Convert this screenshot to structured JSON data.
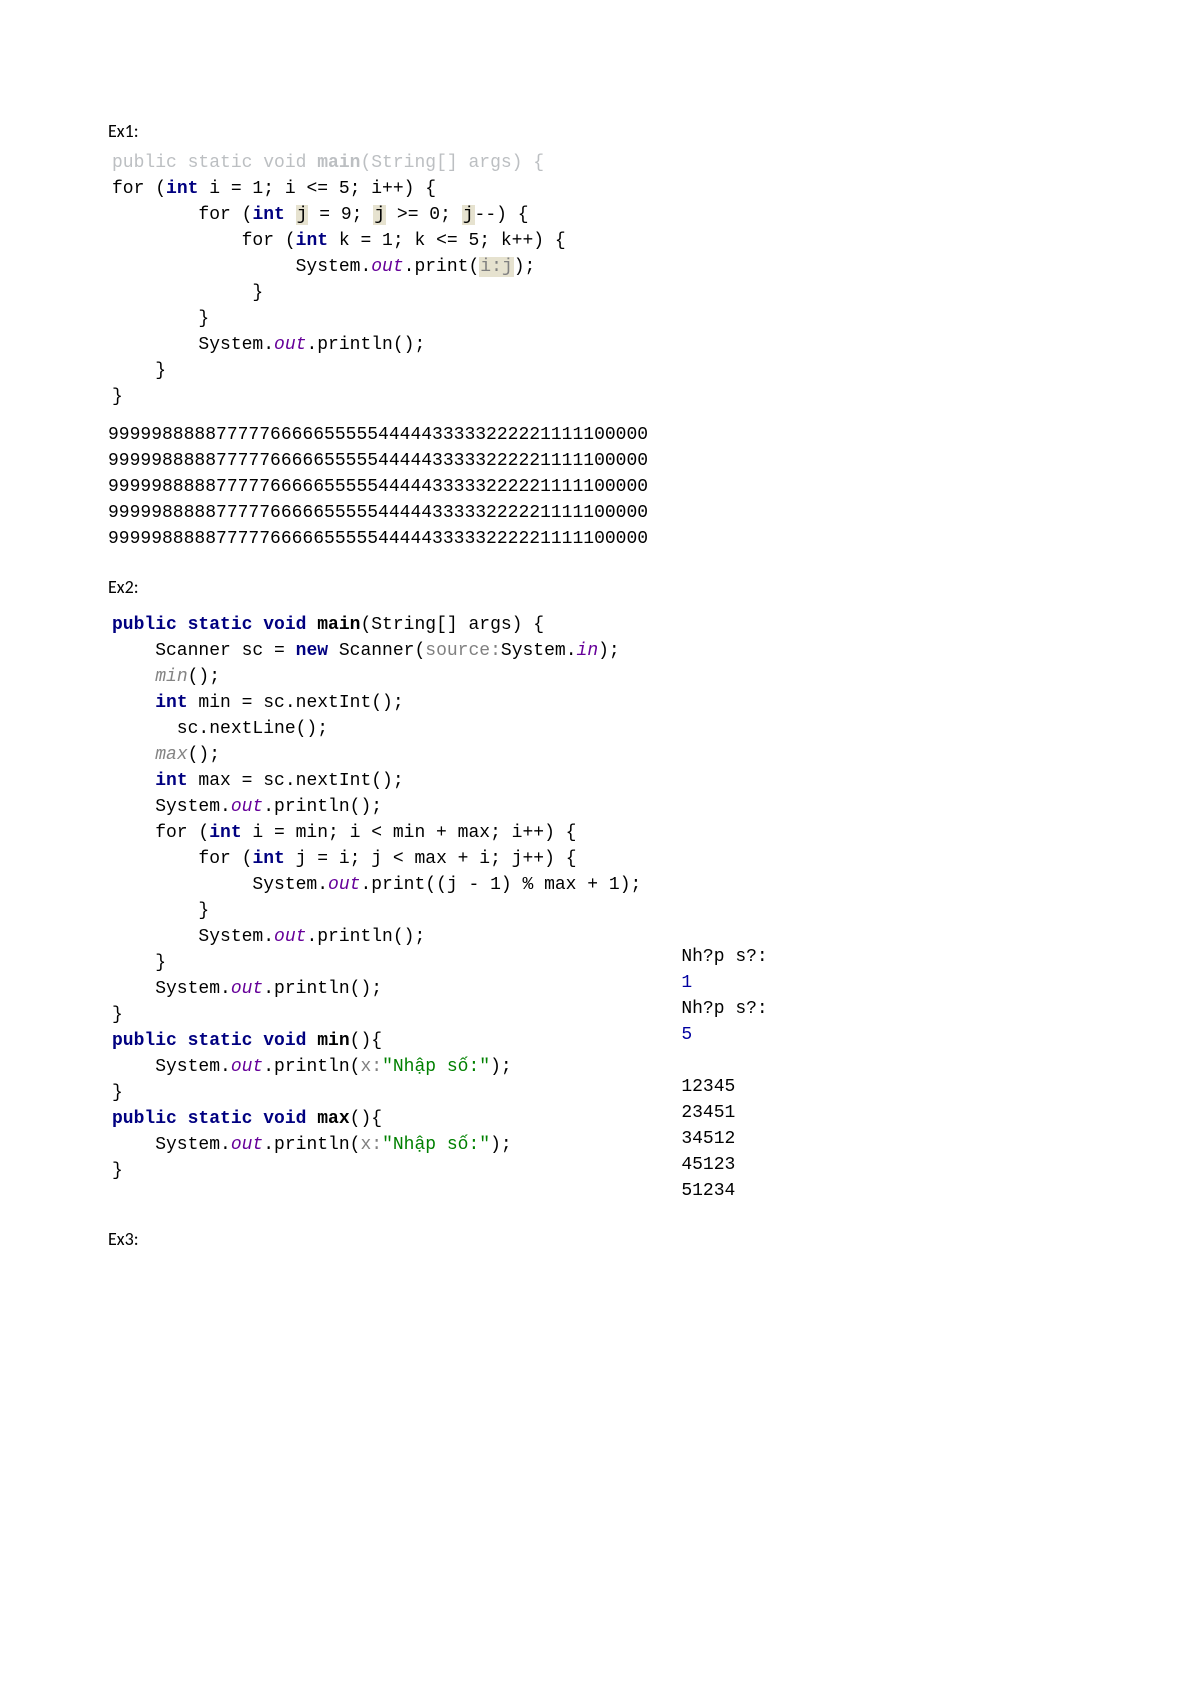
{
  "ex1": {
    "label": "Ex1:",
    "code": {
      "l0_pre": "public static void ",
      "l0_main": "main",
      "l0_post": "(String[] args) {",
      "l1_pre": "for (",
      "l1_int": "int",
      "l1_mid": " i = 1; i <= 5; i++) {",
      "l2_pre": "        for (",
      "l2_int": "int",
      "l2_a": " ",
      "l2_j1": "j",
      "l2_b": " = 9; ",
      "l2_j2": "j",
      "l2_c": " >= 0; ",
      "l2_j3": "j",
      "l2_d": "--) {",
      "l3_pre": "            for (",
      "l3_int": "int",
      "l3_rest": " k = 1; k <= 5; k++) {",
      "l4_pre": "                 System.",
      "l4_out": "out",
      "l4_mid": ".print(",
      "l4_arg": "i:j",
      "l4_end": ");",
      "l5": "             }",
      "l6": "        }",
      "l7_pre": "        System.",
      "l7_out": "out",
      "l7_end": ".println();",
      "l8": "    }",
      "l9": "}"
    },
    "output": "99999888887777766666555554444433333222221111100000\n99999888887777766666555554444433333222221111100000\n99999888887777766666555554444433333222221111100000\n99999888887777766666555554444433333222221111100000\n99999888887777766666555554444433333222221111100000"
  },
  "ex2": {
    "label": "Ex2:",
    "code": {
      "l0_pre": "public static void ",
      "l0_main": "main",
      "l0_post": "(String[] args) {",
      "l1_a": "    Scanner sc = ",
      "l1_new": "new",
      "l1_b": " Scanner(",
      "l1_hint": "source:",
      "l1_c": "System.",
      "l1_in": "in",
      "l1_d": ");",
      "l2": "    ",
      "l2_min": "min",
      "l2_end": "();",
      "l3_a": "    ",
      "l3_int": "int",
      "l3_b": " min = sc.nextInt();",
      "l4": "      sc.nextLine();",
      "l5": "    ",
      "l5_max": "max",
      "l5_end": "();",
      "l6_a": "    ",
      "l6_int": "int",
      "l6_b": " max = sc.nextInt();",
      "l7_a": "    System.",
      "l7_out": "out",
      "l7_b": ".println();",
      "l8_a": "    for (",
      "l8_int": "int",
      "l8_b": " i = min; i < min + max; i++) {",
      "l9_a": "        for (",
      "l9_int": "int",
      "l9_b": " j = i; j < max + i; j++) {",
      "l10_a": "             System.",
      "l10_out": "out",
      "l10_b": ".print((j - 1) % max + 1);",
      "l11": "        }",
      "l12_a": "        System.",
      "l12_out": "out",
      "l12_b": ".println();",
      "l13": "    }",
      "l14_a": "    System.",
      "l14_out": "out",
      "l14_b": ".println();",
      "l15": "}",
      "l16_a": "public static void ",
      "l16_min": "min",
      "l16_b": "(){",
      "l17_a": "    System.",
      "l17_out": "out",
      "l17_b": ".println(",
      "l17_hint": "x:",
      "l17_str": "\"Nhập số:\"",
      "l17_c": ");",
      "l18": "}",
      "l19_a": "public static void ",
      "l19_max": "max",
      "l19_b": "(){",
      "l20_a": "    System.",
      "l20_out": "out",
      "l20_b": ".println(",
      "l20_hint": "x:",
      "l20_str": "\"Nhập số:\"",
      "l20_c": ");",
      "l21": "}"
    },
    "output": {
      "p1": "Nh?p s?:",
      "v1": "1",
      "p2": "Nh?p s?:",
      "v2": "5",
      "blank": "",
      "r1": "12345",
      "r2": "23451",
      "r3": "34512",
      "r4": "45123",
      "r5": "51234"
    }
  },
  "ex3": {
    "label": "Ex3:"
  }
}
